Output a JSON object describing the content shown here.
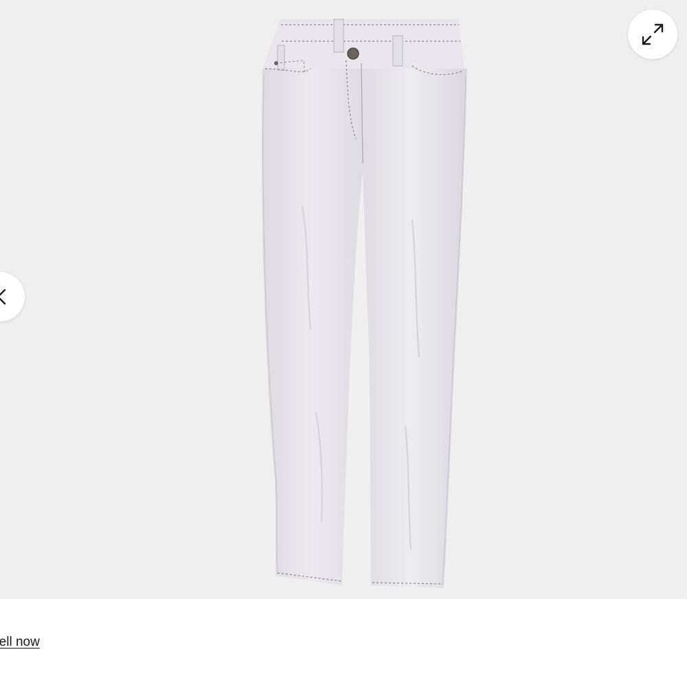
{
  "viewer": {
    "background": "#efefef",
    "product_color": "#e6e4ea",
    "stitch_color": "#8a8580",
    "expand_icon": "expand-arrows-icon",
    "prev_icon": "chevron-left-icon"
  },
  "footer": {
    "link_label": "Sell now"
  }
}
